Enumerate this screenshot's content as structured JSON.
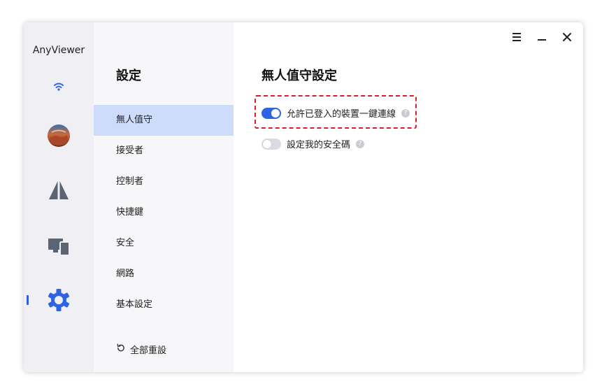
{
  "app": {
    "title": "AnyViewer"
  },
  "colors": {
    "accent": "#2f63e6",
    "highlight": "#e01b24",
    "nav_active": "#cddcfb"
  },
  "rail": {
    "items": [
      {
        "icon": "wifi-icon"
      },
      {
        "icon": "avatar"
      },
      {
        "icon": "remote-triangles-icon"
      },
      {
        "icon": "devices-icon"
      },
      {
        "icon": "gear-icon",
        "active": true
      }
    ]
  },
  "window_controls": {
    "menu": "menu-icon",
    "minimize": "minimize-icon",
    "close": "close-icon"
  },
  "settings_nav": {
    "title": "設定",
    "items": [
      {
        "label": "無人值守",
        "active": true
      },
      {
        "label": "接受者"
      },
      {
        "label": "控制者"
      },
      {
        "label": "快捷鍵"
      },
      {
        "label": "安全"
      },
      {
        "label": "網路"
      },
      {
        "label": "基本設定"
      }
    ],
    "reset_label": "全部重設"
  },
  "main": {
    "title": "無人值守設定",
    "settings": [
      {
        "label": "允許已登入的裝置一鍵連線",
        "enabled": true
      },
      {
        "label": "設定我的安全碼",
        "enabled": false
      }
    ],
    "help_glyph": "?"
  }
}
